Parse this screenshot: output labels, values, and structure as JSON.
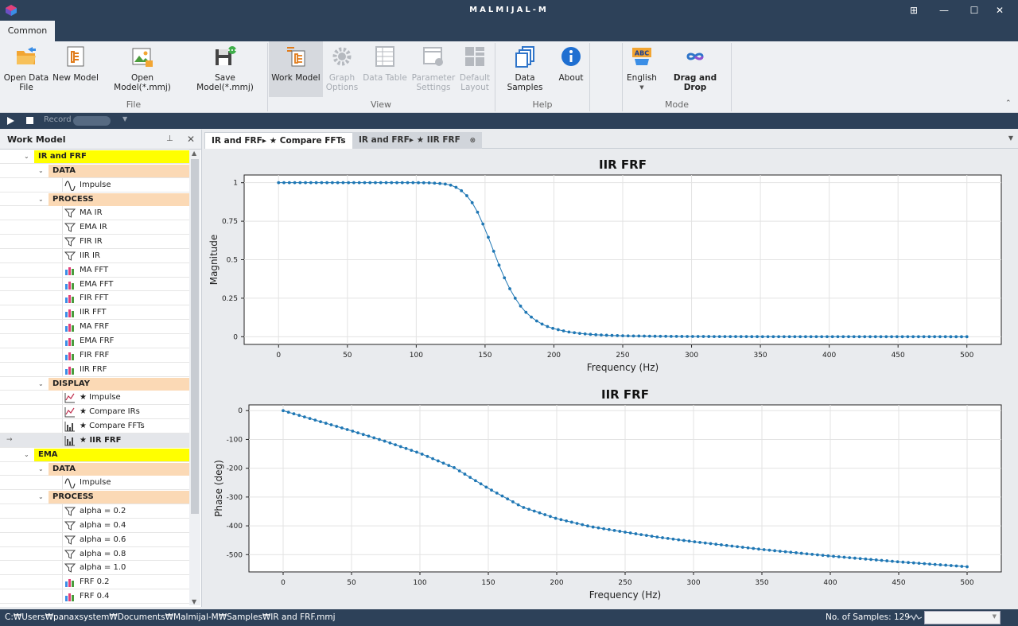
{
  "window": {
    "title": "MALMIJAL-M",
    "controls": [
      "⊞",
      "—",
      "☐",
      "✕"
    ]
  },
  "ribbon": {
    "tab": "Common",
    "file": {
      "group": "File",
      "open_data_file": "Open Data File",
      "new_model": "New Model",
      "open_model": "Open Model(*.mmj)",
      "save_model": "Save Model(*.mmj)"
    },
    "view": {
      "group": "View",
      "work_model": "Work Model",
      "graph_options": "Graph Options",
      "data_table": "Data Table",
      "parameter_settings": "Parameter Settings",
      "default_layout": "Default Layout"
    },
    "help": {
      "group": "Help",
      "data_samples": "Data Samples",
      "about": "About"
    },
    "mode": {
      "group": "Mode",
      "language": "English",
      "drag_drop": "Drag and Drop",
      "language_badge": "ABC"
    }
  },
  "player": {
    "record_label": "Record"
  },
  "panel": {
    "title": "Work Model"
  },
  "tree": [
    {
      "type": "group",
      "label": "IR and FRF"
    },
    {
      "type": "sub",
      "label": "DATA"
    },
    {
      "type": "leaf",
      "icon": "wave",
      "label": "Impulse"
    },
    {
      "type": "sub",
      "label": "PROCESS"
    },
    {
      "type": "leaf",
      "icon": "filter",
      "label": "MA IR"
    },
    {
      "type": "leaf",
      "icon": "filter",
      "label": "EMA IR"
    },
    {
      "type": "leaf",
      "icon": "filter",
      "label": "FIR IR"
    },
    {
      "type": "leaf",
      "icon": "filter",
      "label": "IIR IR"
    },
    {
      "type": "leaf",
      "icon": "bars",
      "label": "MA FFT"
    },
    {
      "type": "leaf",
      "icon": "bars",
      "label": "EMA FFT"
    },
    {
      "type": "leaf",
      "icon": "bars",
      "label": "FIR FFT"
    },
    {
      "type": "leaf",
      "icon": "bars",
      "label": "IIR FFT"
    },
    {
      "type": "leaf",
      "icon": "bars",
      "label": "MA FRF"
    },
    {
      "type": "leaf",
      "icon": "bars",
      "label": "EMA FRF"
    },
    {
      "type": "leaf",
      "icon": "bars",
      "label": "FIR FRF"
    },
    {
      "type": "leaf",
      "icon": "bars",
      "label": "IIR FRF"
    },
    {
      "type": "sub",
      "label": "DISPLAY"
    },
    {
      "type": "leaf",
      "icon": "linechart",
      "label": "★ Impulse"
    },
    {
      "type": "leaf",
      "icon": "linechart",
      "label": "★ Compare IRs"
    },
    {
      "type": "leaf",
      "icon": "barchart",
      "label": "★ Compare FFTs"
    },
    {
      "type": "leaf",
      "icon": "barchart",
      "label": "★ IIR FRF",
      "selected": true
    },
    {
      "type": "group",
      "label": "EMA"
    },
    {
      "type": "sub",
      "label": "DATA"
    },
    {
      "type": "leaf",
      "icon": "wave",
      "label": "Impulse"
    },
    {
      "type": "sub",
      "label": "PROCESS"
    },
    {
      "type": "leaf",
      "icon": "filter",
      "label": "alpha = 0.2"
    },
    {
      "type": "leaf",
      "icon": "filter",
      "label": "alpha = 0.4"
    },
    {
      "type": "leaf",
      "icon": "filter",
      "label": "alpha = 0.6"
    },
    {
      "type": "leaf",
      "icon": "filter",
      "label": "alpha = 0.8"
    },
    {
      "type": "leaf",
      "icon": "filter",
      "label": "alpha = 1.0"
    },
    {
      "type": "leaf",
      "icon": "bars",
      "label": "FRF 0.2"
    },
    {
      "type": "leaf",
      "icon": "bars",
      "label": "FRF 0.4"
    }
  ],
  "doc_tabs": [
    {
      "label": "IR and FRF▸ ★ Compare FFTs",
      "active": true
    },
    {
      "label": "IR and FRF▸ ★ IIR FRF",
      "active": false
    }
  ],
  "chart_data": [
    {
      "type": "line",
      "title": "IIR FRF",
      "xlabel": "Frequency (Hz)",
      "ylabel": "Magnitude",
      "xlim": [
        -25,
        525
      ],
      "ylim": [
        -0.05,
        1.05
      ],
      "xticks": [
        0,
        50,
        100,
        150,
        200,
        250,
        300,
        350,
        400,
        450,
        500
      ],
      "yticks": [
        0,
        0.25,
        0.5,
        0.75,
        1
      ],
      "ytick_labels": [
        "0",
        "0.25",
        "0.5",
        "0.75",
        "1"
      ],
      "grid": true,
      "color": "#1f77b4",
      "x": [
        0,
        25,
        50,
        75,
        100,
        110,
        120,
        125,
        130,
        135,
        140,
        145,
        150,
        155,
        160,
        165,
        170,
        175,
        180,
        185,
        190,
        195,
        200,
        210,
        220,
        230,
        240,
        250,
        275,
        300,
        350,
        400,
        450,
        500
      ],
      "y": [
        1.0,
        1.0,
        1.0,
        1.0,
        1.0,
        0.999,
        0.993,
        0.984,
        0.966,
        0.934,
        0.88,
        0.801,
        0.7,
        0.584,
        0.468,
        0.363,
        0.276,
        0.207,
        0.155,
        0.117,
        0.088,
        0.067,
        0.052,
        0.032,
        0.02,
        0.013,
        0.009,
        0.006,
        0.003,
        0.0015,
        0.0005,
        0.0002,
        0.0001,
        0.0
      ]
    },
    {
      "type": "line",
      "title": "IIR FRF",
      "xlabel": "Frequency (Hz)",
      "ylabel": "Phase (deg)",
      "xlim": [
        -25,
        525
      ],
      "ylim": [
        -560,
        20
      ],
      "xticks": [
        0,
        50,
        100,
        150,
        200,
        250,
        300,
        350,
        400,
        450,
        500
      ],
      "yticks": [
        0,
        -100,
        -200,
        -300,
        -400,
        -500
      ],
      "grid": true,
      "color": "#1f77b4",
      "x": [
        0,
        25,
        50,
        75,
        100,
        125,
        150,
        175,
        200,
        225,
        250,
        275,
        300,
        350,
        400,
        450,
        500
      ],
      "y": [
        0,
        -35,
        -70,
        -107,
        -148,
        -198,
        -270,
        -335,
        -375,
        -403,
        -422,
        -440,
        -455,
        -482,
        -505,
        -525,
        -542
      ]
    }
  ],
  "status": {
    "path": "C:₩Users₩panaxsystem₩Documents₩Malmijal-M₩Samples₩IR and FRF.mmj",
    "samples": "No. of Samples: 129"
  }
}
